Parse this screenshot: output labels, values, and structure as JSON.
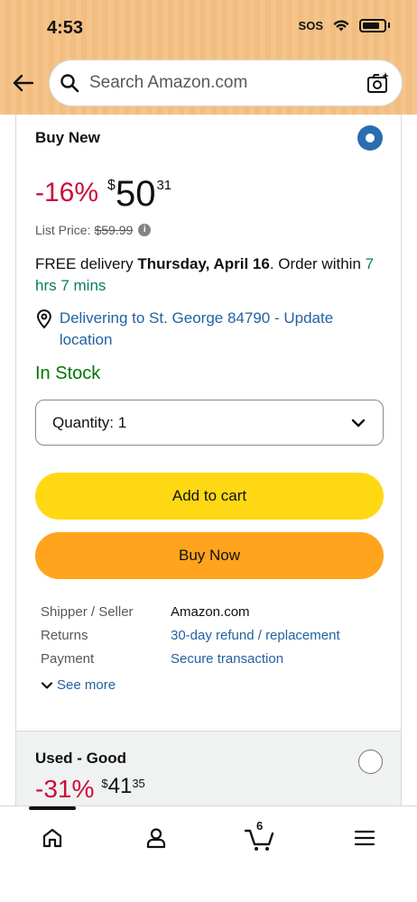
{
  "status_bar": {
    "time": "4:53",
    "sos": "SOS"
  },
  "search": {
    "placeholder": "Search Amazon.com"
  },
  "buy_new": {
    "title": "Buy New",
    "selected": true,
    "discount": "-16%",
    "currency": "$",
    "price_whole": "50",
    "price_fraction": "31",
    "list_price_label": "List Price:",
    "list_price": "$59.99",
    "delivery_prefix": "FREE delivery",
    "delivery_date": "Thursday, April 16",
    "delivery_suffix": ". Order within",
    "delivery_countdown": "7 hrs 7 mins",
    "location_text": "Delivering to St. George 84790 - Update location",
    "stock_status": "In Stock",
    "quantity_label": "Quantity: 1",
    "add_to_cart_label": "Add to cart",
    "buy_now_label": "Buy Now",
    "details": [
      {
        "label": "Shipper / Seller",
        "value": "Amazon.com",
        "link": false
      },
      {
        "label": "Returns",
        "value": "30-day refund / replacement",
        "link": true
      },
      {
        "label": "Payment",
        "value": "Secure transaction",
        "link": true
      }
    ],
    "see_more_label": "See more"
  },
  "used_good": {
    "title": "Used - Good",
    "selected": false,
    "discount": "-31%",
    "currency": "$",
    "price_whole": "41",
    "price_fraction": "35"
  },
  "bottom_nav": {
    "items": [
      "home-icon",
      "account-icon",
      "cart-icon",
      "menu-icon"
    ],
    "cart_count": "6"
  },
  "colors": {
    "header_bg": "#f5c48a",
    "discount_red": "#cc0c39",
    "link_blue": "#2162a1",
    "in_stock_green": "#007600",
    "countdown_green": "#067d62",
    "add_to_cart_yellow": "#ffd814",
    "buy_now_orange": "#ffa41c",
    "radio_selected_blue": "#2a6db0"
  }
}
